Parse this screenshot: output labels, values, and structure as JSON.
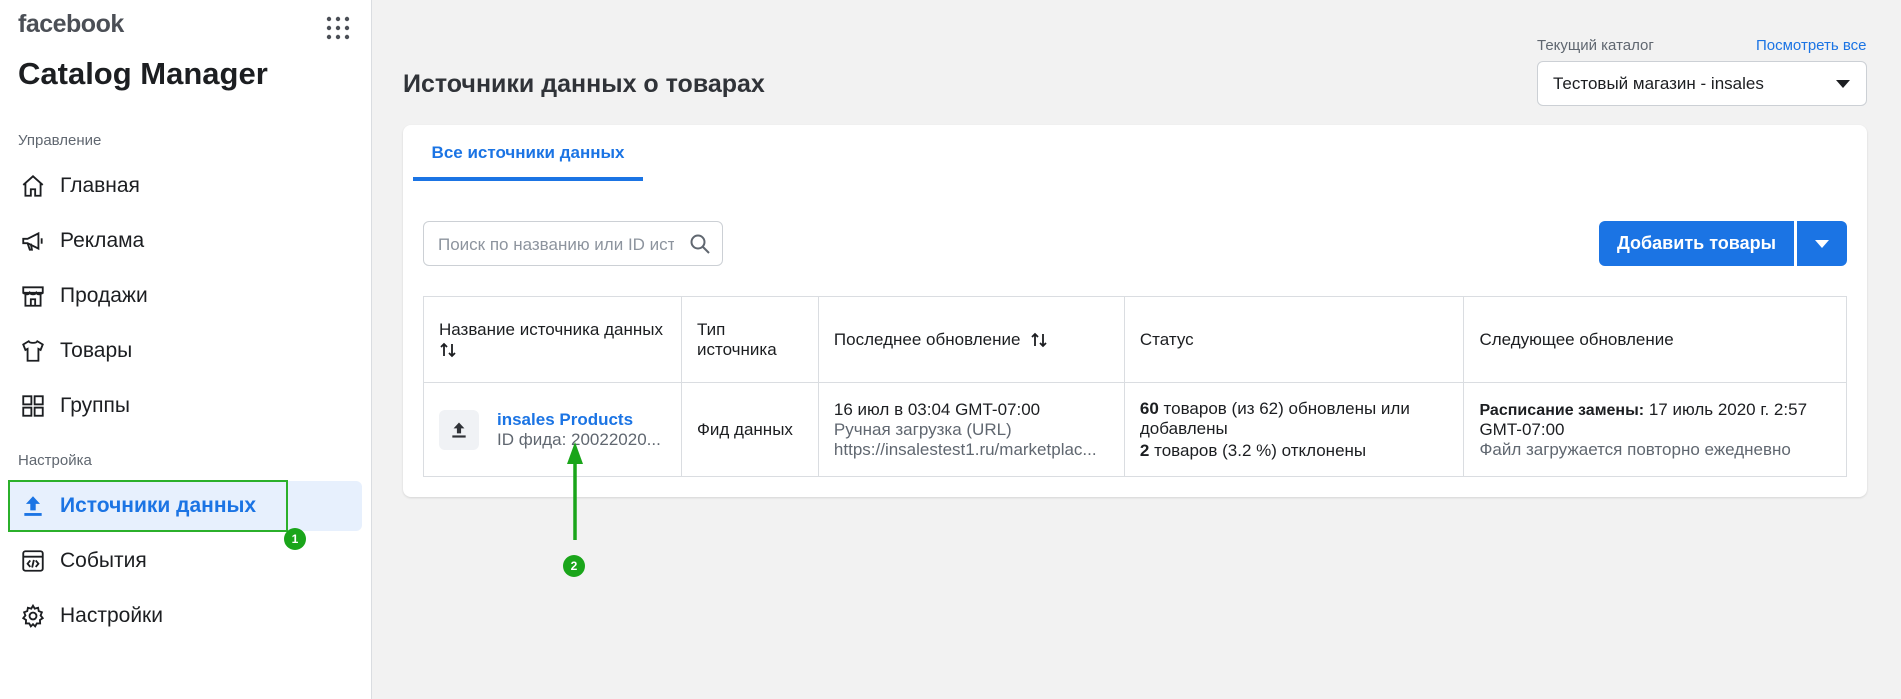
{
  "brand": "facebook",
  "app_title": "Catalog Manager",
  "sidebar": {
    "section_manage": "Управление",
    "items_manage": [
      {
        "label": "Главная",
        "icon": "home-icon"
      },
      {
        "label": "Реклама",
        "icon": "megaphone-icon"
      },
      {
        "label": "Продажи",
        "icon": "shop-icon"
      },
      {
        "label": "Товары",
        "icon": "tshirt-icon"
      },
      {
        "label": "Группы",
        "icon": "grid-squares-icon"
      }
    ],
    "section_settings": "Настройка",
    "items_settings": [
      {
        "label": "Источники данных",
        "icon": "upload-icon",
        "active": true
      },
      {
        "label": "События",
        "icon": "code-window-icon"
      },
      {
        "label": "Настройки",
        "icon": "gear-icon"
      }
    ]
  },
  "markers": [
    "1",
    "2"
  ],
  "header": {
    "title": "Источники данных о товарах",
    "catalog_label": "Текущий каталог",
    "see_all": "Посмотреть все",
    "catalog_value": "Тестовый магазин - insales"
  },
  "tabs": [
    {
      "label": "Все источники данных",
      "active": true
    }
  ],
  "search": {
    "placeholder": "Поиск по названию или ID ист..."
  },
  "add_button": "Добавить товары",
  "table": {
    "headers": {
      "name": "Название источника данных",
      "type": "Тип источника",
      "last_update": "Последнее обновление",
      "status": "Статус",
      "next_update": "Следующее обновление"
    },
    "rows": [
      {
        "name": "insales Products",
        "feed_id": "ID фида: 20022020...",
        "type": "Фид данных",
        "last_update_date": "16 июл в 03:04 GMT-07:00",
        "last_update_method": "Ручная загрузка (URL)",
        "last_update_url": "https://insalestest1.ru/marketplac...",
        "status_updated_count": "60",
        "status_updated_text": "товаров (из 62) обновлены или добавлены",
        "status_rejected_count": "2",
        "status_rejected_text": "товаров (3.2 %) отклонены",
        "next_label": "Расписание замены:",
        "next_date": "17 июль 2020 г. 2:57 GMT-07:00",
        "next_note": "Файл загружается повторно ежедневно"
      }
    ]
  },
  "colors": {
    "accent": "#1b74e4",
    "annotation": "#1aa51a",
    "active_bg": "#e7f0fd"
  }
}
